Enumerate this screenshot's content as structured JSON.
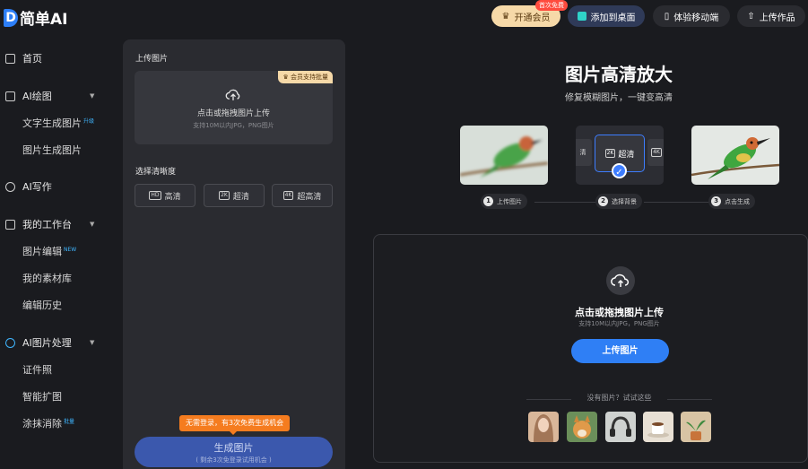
{
  "header": {
    "logo_mark": "D",
    "logo_text": "简单AI",
    "vip_badge": "首次免费",
    "vip_label": "开通会员",
    "desktop_label": "添加到桌面",
    "mobile_label": "体验移动端",
    "upload_label": "上传作品"
  },
  "sidebar": {
    "home": "首页",
    "ai_draw": "AI绘图",
    "text_to_image": "文字生成图片",
    "text_to_image_tag": "升级",
    "image_to_image": "图片生成图片",
    "ai_write": "AI写作",
    "workbench": "我的工作台",
    "image_edit": "图片编辑",
    "image_edit_tag": "NEW",
    "materials": "我的素材库",
    "history": "编辑历史",
    "ai_image": "AI图片处理",
    "id_photo": "证件照",
    "smart_expand": "智能扩图",
    "erase": "涂抹消除",
    "erase_tag": "批量"
  },
  "panel": {
    "upload_title": "上传图片",
    "member_tag": "会员支持批量",
    "upload_text": "点击或拖拽图片上传",
    "upload_sub": "支持10M以内JPG，PNG图片",
    "res_title": "选择清晰度",
    "res_hd": "高清",
    "res_hd_icon": "HD",
    "res_2k": "超清",
    "res_2k_icon": "2K",
    "res_4k": "超高清",
    "res_4k_icon": "4K",
    "trial_tip": "无需登录，有3次免费生成机会",
    "gen_label": "生成图片",
    "gen_sub": "( 剩余3次免登录试用机会 )"
  },
  "main": {
    "title": "图片高清放大",
    "subtitle": "修复模糊图片，一键变高清",
    "mid_left": "清",
    "mid_center_icon": "2K",
    "mid_center": "超清",
    "mid_right": "4K",
    "step1_num": "1",
    "step1": "上传图片",
    "step2_num": "2",
    "step2": "选择背景",
    "step3_num": "3",
    "step3": "点击生成",
    "drop_text": "点击或拖拽图片上传",
    "drop_sub": "支持10M以内JPG，PNG图片",
    "drop_btn": "上传图片",
    "try_text": "没有图片？试试这些"
  },
  "colors": {
    "accent": "#2f7ff5",
    "vip": "#f6d9a8",
    "tip": "#f57c1f"
  }
}
